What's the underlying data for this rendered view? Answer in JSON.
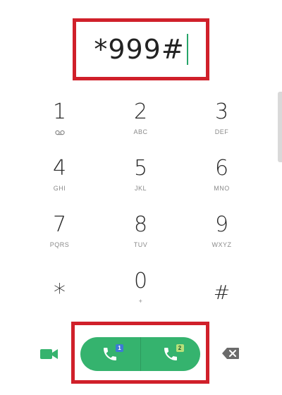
{
  "display": {
    "number": "*999#"
  },
  "keypad": [
    {
      "digit": "1",
      "letters": "",
      "icon": "voicemail-icon"
    },
    {
      "digit": "2",
      "letters": "ABC"
    },
    {
      "digit": "3",
      "letters": "DEF"
    },
    {
      "digit": "4",
      "letters": "GHI"
    },
    {
      "digit": "5",
      "letters": "JKL"
    },
    {
      "digit": "6",
      "letters": "MNO"
    },
    {
      "digit": "7",
      "letters": "PQRS"
    },
    {
      "digit": "8",
      "letters": "TUV"
    },
    {
      "digit": "9",
      "letters": "WXYZ"
    },
    {
      "digit": "*",
      "letters": ""
    },
    {
      "digit": "0",
      "letters": "+"
    },
    {
      "digit": "#",
      "letters": ""
    }
  ],
  "actions": {
    "video_call_icon": "video-camera-icon",
    "call_sim1_badge": "1",
    "call_sim2_badge": "2",
    "backspace_icon": "backspace-icon"
  },
  "colors": {
    "call_green": "#35b36e",
    "highlight_red": "#d0202a",
    "cursor_green": "#27a56a",
    "sim1_blue": "#3d7ad6",
    "sim2_lime": "#b7e07a"
  }
}
